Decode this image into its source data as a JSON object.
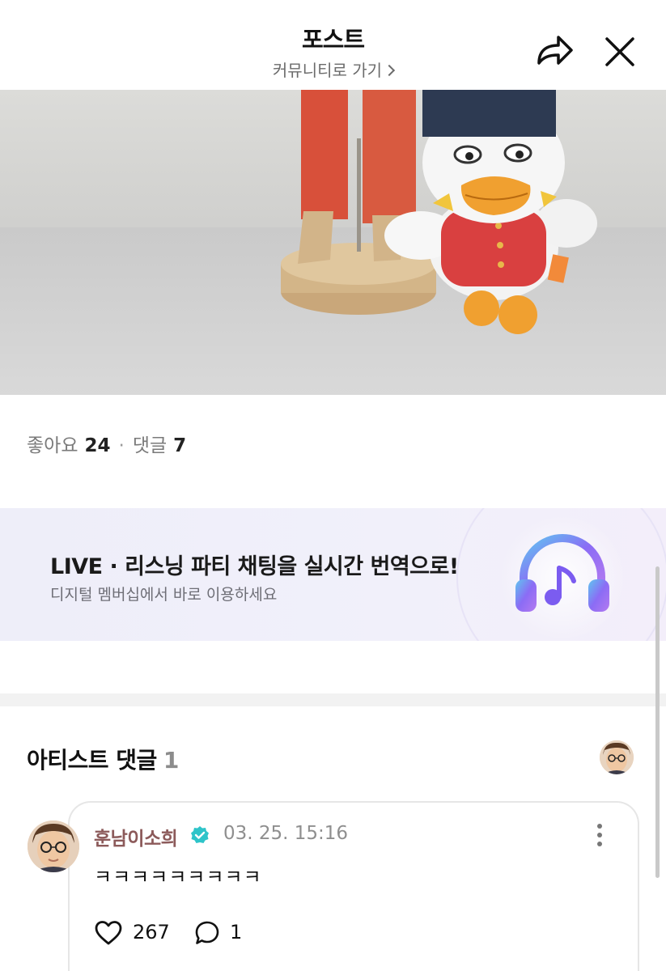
{
  "header": {
    "title": "포스트",
    "community_link": "커뮤니티로 가기"
  },
  "post": {
    "likes_label": "좋아요",
    "likes_count": "24",
    "comments_label": "댓글",
    "comments_count": "7"
  },
  "banner": {
    "title": "LIVE · 리스닝 파티 채팅을 실시간 번역으로!",
    "subtitle": "디지털 멤버십에서 바로 이용하세요",
    "icon": "headphones-music-icon"
  },
  "artist_comments": {
    "title": "아티스트 댓글",
    "count": "1",
    "items": [
      {
        "author": "훈남이소희",
        "verified": true,
        "date": "03. 25. 15:16",
        "text": "ㅋㅋㅋㅋㅋㅋㅋㅋㅋ",
        "likes": "267",
        "replies": "1"
      }
    ]
  },
  "colors": {
    "author_name": "#8c5a5a",
    "verified_badge": "#2ec4c9",
    "banner_bg": "#eeeef9",
    "headphone_accent": "#7b5cf0"
  }
}
